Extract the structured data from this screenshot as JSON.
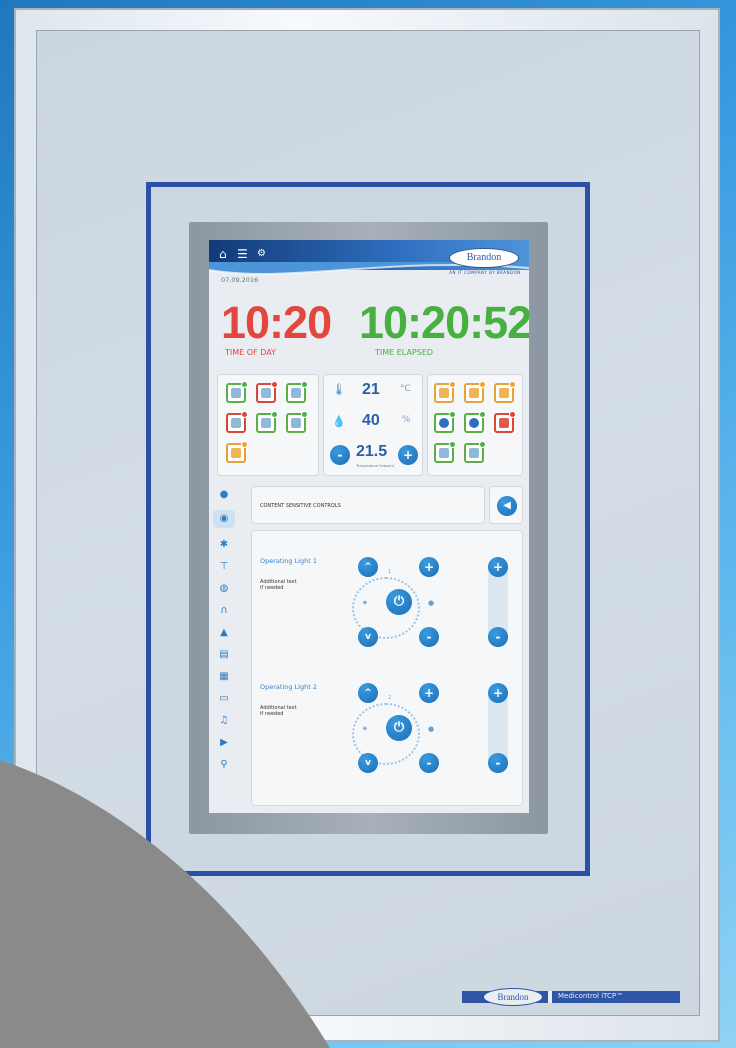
{
  "header": {
    "brand": "Brandon",
    "tagline": "AN IT COMPANY BY BRANDON",
    "date": "07.09.2016"
  },
  "clock": {
    "time_of_day": "10:20",
    "time_of_day_label": "TIME OF DAY",
    "time_elapsed": "10:20:52",
    "time_elapsed_label": "TIME ELAPSED"
  },
  "environment": {
    "temperature": "21",
    "temperature_unit": "°C",
    "humidity": "40",
    "humidity_unit": "%",
    "setpoint": "21.5",
    "setpoint_caption": "Temperature Setpoint",
    "minus_label": "-",
    "plus_label": "+"
  },
  "content": {
    "title": "CONTENT SENSITIVE CONTROLS",
    "lights": [
      {
        "name": "Operating Light 1",
        "note": "Additional text if needed",
        "index": "1"
      },
      {
        "name": "Operating Light 2",
        "note": "Additional text if needed",
        "index": "2"
      }
    ]
  },
  "nameplate": {
    "brand": "Brandon",
    "product": "Medicontrol iTCP™"
  },
  "colors": {
    "time_of_day": "#e2463e",
    "time_elapsed": "#48b041",
    "accent": "#1d6db4",
    "frame_blue": "#2c4fa7"
  },
  "icons": [
    "home-icon",
    "list-icon",
    "gear-icon",
    "thermometer-icon",
    "humidity-icon",
    "speaker-icon",
    "power-icon",
    "bulb-icon"
  ]
}
